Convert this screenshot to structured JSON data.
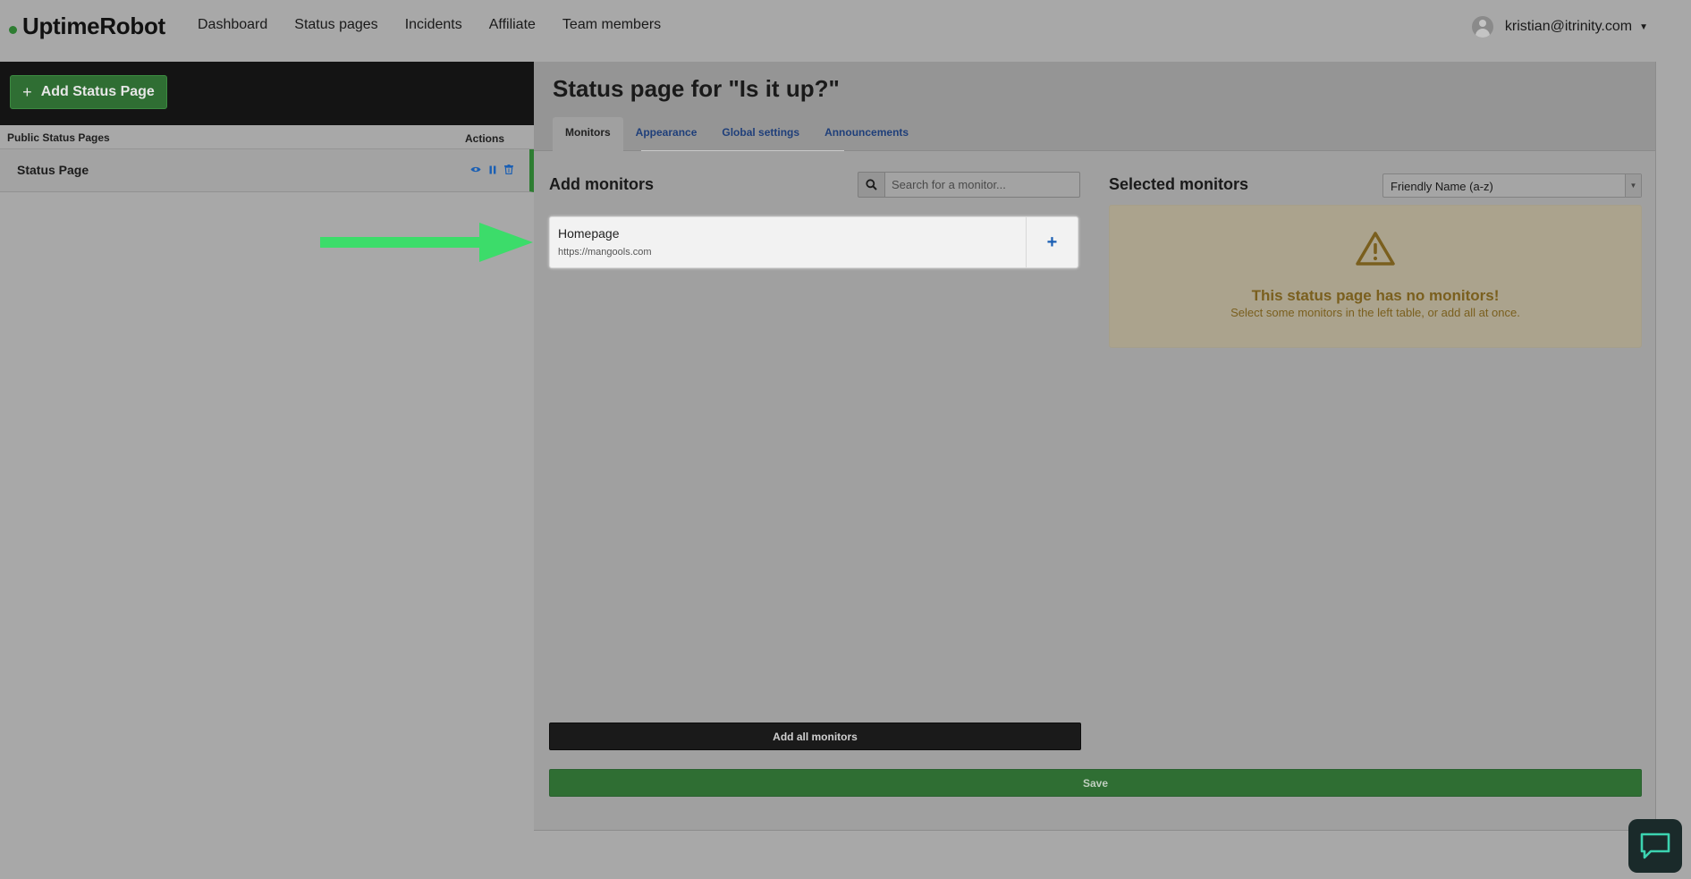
{
  "brand": {
    "name": "UptimeRobot",
    "accent": "#2e7d32"
  },
  "nav": {
    "items": [
      {
        "label": "Dashboard"
      },
      {
        "label": "Status pages"
      },
      {
        "label": "Incidents"
      },
      {
        "label": "Affiliate"
      },
      {
        "label": "Team members"
      }
    ]
  },
  "user": {
    "email": "kristian@itrinity.com",
    "icon": "user-avatar-icon"
  },
  "sidebar": {
    "add_button_label": "Add Status Page",
    "columns": {
      "pages": "Public Status Pages",
      "actions": "Actions"
    },
    "rows": [
      {
        "name": "Status Page",
        "actions": [
          "eye-icon",
          "pause-icon",
          "trash-icon"
        ]
      }
    ]
  },
  "main": {
    "title": "Status page for \"Is it up?\"",
    "tabs": [
      {
        "label": "Monitors",
        "active": true
      },
      {
        "label": "Appearance",
        "active": false
      },
      {
        "label": "Global settings",
        "active": false
      },
      {
        "label": "Announcements",
        "active": false
      }
    ],
    "add_monitors": {
      "title": "Add monitors",
      "search_placeholder": "Search for a monitor...",
      "monitors": [
        {
          "name": "Homepage",
          "url": "https://mangools.com",
          "add_label": "+"
        }
      ],
      "add_all_label": "Add all monitors"
    },
    "selected_monitors": {
      "title": "Selected monitors",
      "sort_value": "Friendly Name (a-z)",
      "empty_title": "This status page has no monitors!",
      "empty_subtitle": "Select some monitors in the left table, or add all at once.",
      "empty_icon": "warning-triangle-icon"
    },
    "save_label": "Save"
  },
  "chat_widget": {
    "icon": "chat-bubble-icon"
  }
}
